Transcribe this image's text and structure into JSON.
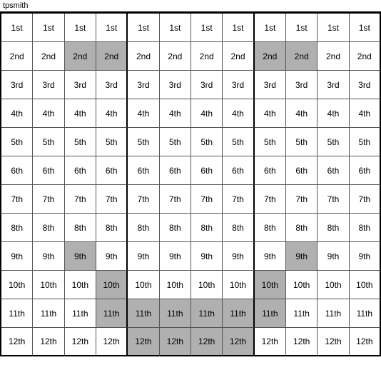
{
  "title": "tpsmith",
  "rows": [
    {
      "label": "1st",
      "cells": [
        {
          "text": "1st",
          "h": false
        },
        {
          "text": "1st",
          "h": false
        },
        {
          "text": "1st",
          "h": false
        },
        {
          "text": "1st",
          "h": false
        },
        {
          "text": "1st",
          "h": false
        },
        {
          "text": "1st",
          "h": false
        },
        {
          "text": "1st",
          "h": false
        },
        {
          "text": "1st",
          "h": false
        },
        {
          "text": "1st",
          "h": false
        },
        {
          "text": "1st",
          "h": false
        },
        {
          "text": "1st",
          "h": false
        },
        {
          "text": "1st",
          "h": false
        }
      ]
    },
    {
      "label": "2nd",
      "cells": [
        {
          "text": "2nd",
          "h": false
        },
        {
          "text": "2nd",
          "h": false
        },
        {
          "text": "2nd",
          "h": true
        },
        {
          "text": "2nd",
          "h": true
        },
        {
          "text": "2nd",
          "h": false
        },
        {
          "text": "2nd",
          "h": false
        },
        {
          "text": "2nd",
          "h": false
        },
        {
          "text": "2nd",
          "h": false
        },
        {
          "text": "2nd",
          "h": true
        },
        {
          "text": "2nd",
          "h": true
        },
        {
          "text": "2nd",
          "h": false
        },
        {
          "text": "2nd",
          "h": false
        }
      ]
    },
    {
      "label": "3rd",
      "cells": [
        {
          "text": "3rd",
          "h": false
        },
        {
          "text": "3rd",
          "h": false
        },
        {
          "text": "3rd",
          "h": false
        },
        {
          "text": "3rd",
          "h": false
        },
        {
          "text": "3rd",
          "h": false
        },
        {
          "text": "3rd",
          "h": false
        },
        {
          "text": "3rd",
          "h": false
        },
        {
          "text": "3rd",
          "h": false
        },
        {
          "text": "3rd",
          "h": false
        },
        {
          "text": "3rd",
          "h": false
        },
        {
          "text": "3rd",
          "h": false
        },
        {
          "text": "3rd",
          "h": false
        }
      ]
    },
    {
      "label": "4th",
      "cells": [
        {
          "text": "4th",
          "h": false
        },
        {
          "text": "4th",
          "h": false
        },
        {
          "text": "4th",
          "h": false
        },
        {
          "text": "4th",
          "h": false
        },
        {
          "text": "4th",
          "h": false
        },
        {
          "text": "4th",
          "h": false
        },
        {
          "text": "4th",
          "h": false
        },
        {
          "text": "4th",
          "h": false
        },
        {
          "text": "4th",
          "h": false
        },
        {
          "text": "4th",
          "h": false
        },
        {
          "text": "4th",
          "h": false
        },
        {
          "text": "4th",
          "h": false
        }
      ]
    },
    {
      "label": "5th",
      "cells": [
        {
          "text": "5th",
          "h": false
        },
        {
          "text": "5th",
          "h": false
        },
        {
          "text": "5th",
          "h": false
        },
        {
          "text": "5th",
          "h": false
        },
        {
          "text": "5th",
          "h": false
        },
        {
          "text": "5th",
          "h": false
        },
        {
          "text": "5th",
          "h": false
        },
        {
          "text": "5th",
          "h": false
        },
        {
          "text": "5th",
          "h": false
        },
        {
          "text": "5th",
          "h": false
        },
        {
          "text": "5th",
          "h": false
        },
        {
          "text": "5th",
          "h": false
        }
      ]
    },
    {
      "label": "6th",
      "cells": [
        {
          "text": "6th",
          "h": false
        },
        {
          "text": "6th",
          "h": false
        },
        {
          "text": "6th",
          "h": false
        },
        {
          "text": "6th",
          "h": false
        },
        {
          "text": "6th",
          "h": false
        },
        {
          "text": "6th",
          "h": false
        },
        {
          "text": "6th",
          "h": false
        },
        {
          "text": "6th",
          "h": false
        },
        {
          "text": "6th",
          "h": false
        },
        {
          "text": "6th",
          "h": false
        },
        {
          "text": "6th",
          "h": false
        },
        {
          "text": "6th",
          "h": false
        }
      ]
    },
    {
      "label": "7th",
      "cells": [
        {
          "text": "7th",
          "h": false
        },
        {
          "text": "7th",
          "h": false
        },
        {
          "text": "7th",
          "h": false
        },
        {
          "text": "7th",
          "h": false
        },
        {
          "text": "7th",
          "h": false
        },
        {
          "text": "7th",
          "h": false
        },
        {
          "text": "7th",
          "h": false
        },
        {
          "text": "7th",
          "h": false
        },
        {
          "text": "7th",
          "h": false
        },
        {
          "text": "7th",
          "h": false
        },
        {
          "text": "7th",
          "h": false
        },
        {
          "text": "7th",
          "h": false
        }
      ]
    },
    {
      "label": "8th",
      "cells": [
        {
          "text": "8th",
          "h": false
        },
        {
          "text": "8th",
          "h": false
        },
        {
          "text": "8th",
          "h": false
        },
        {
          "text": "8th",
          "h": false
        },
        {
          "text": "8th",
          "h": false
        },
        {
          "text": "8th",
          "h": false
        },
        {
          "text": "8th",
          "h": false
        },
        {
          "text": "8th",
          "h": false
        },
        {
          "text": "8th",
          "h": false
        },
        {
          "text": "8th",
          "h": false
        },
        {
          "text": "8th",
          "h": false
        },
        {
          "text": "8th",
          "h": false
        }
      ]
    },
    {
      "label": "9th",
      "cells": [
        {
          "text": "9th",
          "h": false
        },
        {
          "text": "9th",
          "h": false
        },
        {
          "text": "9th",
          "h": true
        },
        {
          "text": "9th",
          "h": false
        },
        {
          "text": "9th",
          "h": false
        },
        {
          "text": "9th",
          "h": false
        },
        {
          "text": "9th",
          "h": false
        },
        {
          "text": "9th",
          "h": false
        },
        {
          "text": "9th",
          "h": false
        },
        {
          "text": "9th",
          "h": true
        },
        {
          "text": "9th",
          "h": false
        },
        {
          "text": "9th",
          "h": false
        }
      ]
    },
    {
      "label": "10th",
      "cells": [
        {
          "text": "10th",
          "h": false
        },
        {
          "text": "10th",
          "h": false
        },
        {
          "text": "10th",
          "h": false
        },
        {
          "text": "10th",
          "h": true
        },
        {
          "text": "10th",
          "h": false
        },
        {
          "text": "10th",
          "h": false
        },
        {
          "text": "10th",
          "h": false
        },
        {
          "text": "10th",
          "h": false
        },
        {
          "text": "10th",
          "h": true
        },
        {
          "text": "10th",
          "h": false
        },
        {
          "text": "10th",
          "h": false
        },
        {
          "text": "10th",
          "h": false
        }
      ]
    },
    {
      "label": "11th",
      "cells": [
        {
          "text": "11th",
          "h": false
        },
        {
          "text": "11th",
          "h": false
        },
        {
          "text": "11th",
          "h": false
        },
        {
          "text": "11th",
          "h": true
        },
        {
          "text": "11th",
          "h": true
        },
        {
          "text": "11th",
          "h": true
        },
        {
          "text": "11th",
          "h": true
        },
        {
          "text": "11th",
          "h": true
        },
        {
          "text": "11th",
          "h": true
        },
        {
          "text": "11th",
          "h": false
        },
        {
          "text": "11th",
          "h": false
        },
        {
          "text": "11th",
          "h": false
        }
      ]
    },
    {
      "label": "12th",
      "cells": [
        {
          "text": "12th",
          "h": false
        },
        {
          "text": "12th",
          "h": false
        },
        {
          "text": "12th",
          "h": false
        },
        {
          "text": "12th",
          "h": false
        },
        {
          "text": "12th",
          "h": true
        },
        {
          "text": "12th",
          "h": true
        },
        {
          "text": "12th",
          "h": true
        },
        {
          "text": "12th",
          "h": true
        },
        {
          "text": "12th",
          "h": false
        },
        {
          "text": "12th",
          "h": false
        },
        {
          "text": "12th",
          "h": false
        },
        {
          "text": "12th",
          "h": false
        }
      ]
    }
  ],
  "thick_col_borders": [
    3,
    7
  ],
  "thick_row_borders": []
}
